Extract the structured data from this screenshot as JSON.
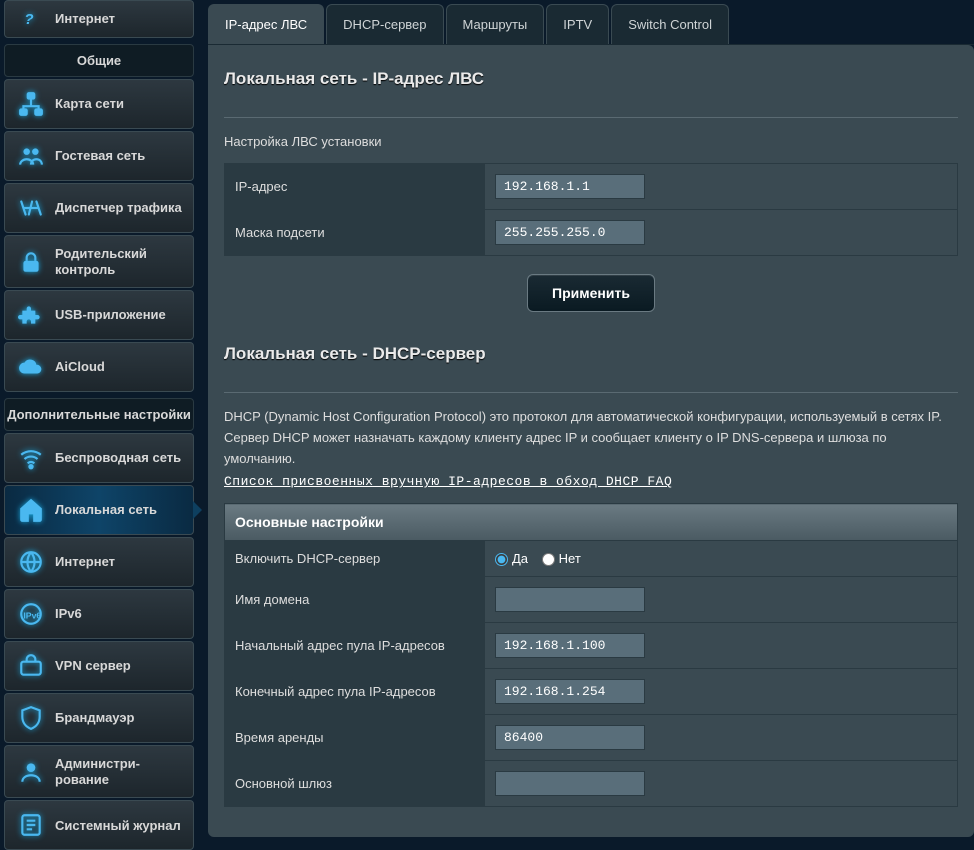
{
  "sidebar": {
    "top_item": "Интернет",
    "header1": "Общие",
    "general": [
      {
        "label": "Карта сети"
      },
      {
        "label": "Гостевая сеть"
      },
      {
        "label": "Диспетчер трафика"
      },
      {
        "label": "Родительский контроль"
      },
      {
        "label": "USB-приложение"
      },
      {
        "label": "AiCloud"
      }
    ],
    "header2": "Дополнительные настройки",
    "advanced": [
      {
        "label": "Беспроводная сеть"
      },
      {
        "label": "Локальная сеть"
      },
      {
        "label": "Интернет"
      },
      {
        "label": "IPv6"
      },
      {
        "label": "VPN сервер"
      },
      {
        "label": "Брандмауэр"
      },
      {
        "label": "Администри-рование"
      },
      {
        "label": "Системный журнал"
      }
    ]
  },
  "tabs": [
    "IP-адрес ЛВС",
    "DHCP-сервер",
    "Маршруты",
    "IPTV",
    "Switch Control"
  ],
  "section1": {
    "title": "Локальная сеть - IP-адрес ЛВС",
    "subtitle": "Настройка ЛВС установки",
    "rows": {
      "ip_label": "IP-адрес",
      "ip_value": "192.168.1.1",
      "mask_label": "Маска подсети",
      "mask_value": "255.255.255.0"
    },
    "apply": "Применить"
  },
  "section2": {
    "title": "Локальная сеть - DHCP-сервер",
    "desc": "DHCP (Dynamic Host Configuration Protocol) это протокол для автоматической конфигурации, используемый в сетях IP. Сервер DHCP может назначать каждому клиенту адрес IP и сообщает клиенту о IP DNS-сервера и шлюза по умолчанию.",
    "faq": "Список присвоенных вручную IP-адресов в обход DHCP FAQ",
    "thead": "Основные настройки",
    "enable_label": "Включить DHCP-сервер",
    "yes": "Да",
    "no": "Нет",
    "domain_label": "Имя домена",
    "domain_value": "",
    "pool_start_label": "Начальный адрес пула IP-адресов",
    "pool_start_value": "192.168.1.100",
    "pool_end_label": "Конечный адрес пула IP-адресов",
    "pool_end_value": "192.168.1.254",
    "lease_label": "Время аренды",
    "lease_value": "86400",
    "gateway_label": "Основной шлюз",
    "gateway_value": ""
  }
}
